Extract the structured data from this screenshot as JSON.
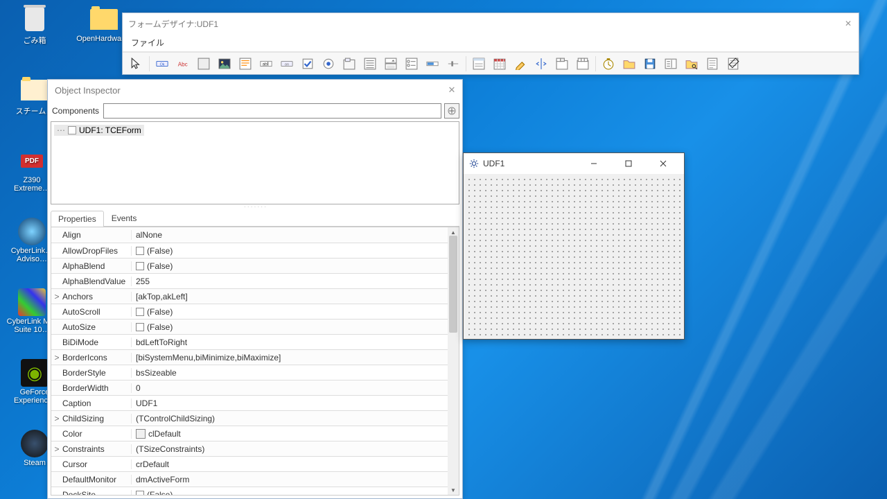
{
  "desktop": {
    "recycle": "ごみ箱",
    "openhw": "OpenHardwar…",
    "steam_jp": "スチーム…",
    "pdf": "Z390 Extreme…",
    "cyberlink1": "CyberLink…\nAdviso…",
    "cyberlink2": "CyberLink M…\nSuite 10…",
    "geforce": "GeForce\nExperienc…",
    "steam": "Steam"
  },
  "designer": {
    "title": "フォームデザイナ:UDF1",
    "menu_file": "ファイル"
  },
  "inspector": {
    "title": "Object Inspector",
    "components_label": "Components",
    "tree_root": "UDF1: TCEForm",
    "tab_properties": "Properties",
    "tab_events": "Events",
    "props": [
      {
        "exp": "",
        "name": "Align",
        "val": "alNone",
        "chk": false
      },
      {
        "exp": "",
        "name": "AllowDropFiles",
        "val": "(False)",
        "chk": true
      },
      {
        "exp": "",
        "name": "AlphaBlend",
        "val": "(False)",
        "chk": true
      },
      {
        "exp": "",
        "name": "AlphaBlendValue",
        "val": "255",
        "chk": false
      },
      {
        "exp": ">",
        "name": "Anchors",
        "val": "[akTop,akLeft]",
        "chk": false
      },
      {
        "exp": "",
        "name": "AutoScroll",
        "val": "(False)",
        "chk": true
      },
      {
        "exp": "",
        "name": "AutoSize",
        "val": "(False)",
        "chk": true
      },
      {
        "exp": "",
        "name": "BiDiMode",
        "val": "bdLeftToRight",
        "chk": false
      },
      {
        "exp": ">",
        "name": "BorderIcons",
        "val": "[biSystemMenu,biMinimize,biMaximize]",
        "chk": false
      },
      {
        "exp": "",
        "name": "BorderStyle",
        "val": "bsSizeable",
        "chk": false
      },
      {
        "exp": "",
        "name": "BorderWidth",
        "val": "0",
        "chk": false
      },
      {
        "exp": "",
        "name": "Caption",
        "val": "UDF1",
        "chk": false
      },
      {
        "exp": ">",
        "name": "ChildSizing",
        "val": "(TControlChildSizing)",
        "chk": false
      },
      {
        "exp": "",
        "name": "Color",
        "val": "clDefault",
        "chk": false,
        "swatch": true
      },
      {
        "exp": ">",
        "name": "Constraints",
        "val": "(TSizeConstraints)",
        "chk": false
      },
      {
        "exp": "",
        "name": "Cursor",
        "val": "crDefault",
        "chk": false
      },
      {
        "exp": "",
        "name": "DefaultMonitor",
        "val": "dmActiveForm",
        "chk": false
      },
      {
        "exp": "",
        "name": "DockSite",
        "val": "(False)",
        "chk": true
      }
    ]
  },
  "preview": {
    "title": "UDF1"
  }
}
